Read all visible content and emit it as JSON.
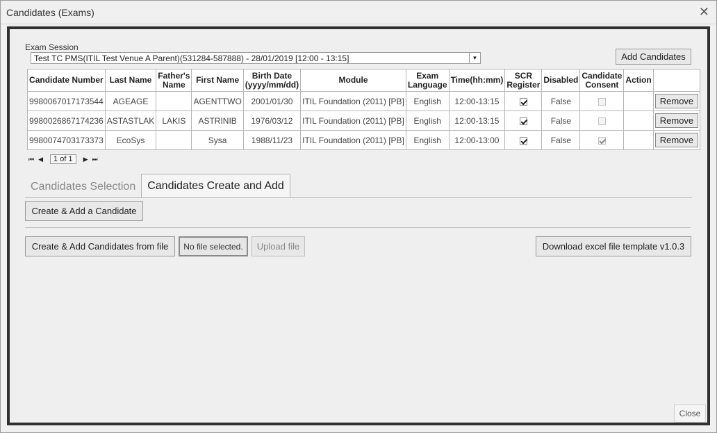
{
  "window": {
    "title": "Candidates (Exams)",
    "close_glyph": "✕"
  },
  "session": {
    "label": "Exam Session",
    "value": "Test TC PMS(ITIL Test Venue A Parent)(531284-587888) - 28/01/2019 [12:00 - 13:15]",
    "dropdown_glyph": "▼"
  },
  "toolbar": {
    "add_candidates": "Add Candidates"
  },
  "table": {
    "headers": {
      "candidate_number": "Candidate Number",
      "last_name": "Last Name",
      "fathers_name_1": "Father's",
      "fathers_name_2": "Name",
      "first_name": "First Name",
      "birth_1": "Birth Date",
      "birth_2": "(yyyy/mm/dd)",
      "module": "Module",
      "exam_lang_1": "Exam",
      "exam_lang_2": "Language",
      "time": "Time(hh:mm)",
      "scr_1": "SCR",
      "scr_2": "Register",
      "disabled": "Disabled",
      "consent_1": "Candidate",
      "consent_2": "Consent",
      "action": "Action"
    },
    "rows": [
      {
        "candidate_number": "9980067017173544",
        "last_name": "AGEAGE",
        "fathers_name": "",
        "first_name": "AGENTTWO",
        "birth_date": "2001/01/30",
        "module": "ITIL Foundation (2011) [PB]",
        "language": "English",
        "time": "12:00-13:15",
        "scr": true,
        "disabled": "False",
        "consent": false,
        "action": "Remove"
      },
      {
        "candidate_number": "9980026867174236",
        "last_name": "ASTASTLAK",
        "fathers_name": "LAKIS",
        "first_name": "ASTRINIB",
        "birth_date": "1976/03/12",
        "module": "ITIL Foundation (2011) [PB]",
        "language": "English",
        "time": "12:00-13:15",
        "scr": true,
        "disabled": "False",
        "consent": false,
        "action": "Remove"
      },
      {
        "candidate_number": "9980074703173373",
        "last_name": "EcoSys",
        "fathers_name": "",
        "first_name": "Sysa",
        "birth_date": "1988/11/23",
        "module": "ITIL Foundation (2011) [PB]",
        "language": "English",
        "time": "12:00-13:00",
        "scr": true,
        "disabled": "False",
        "consent": true,
        "action": "Remove"
      }
    ]
  },
  "pager": {
    "first": "⏮",
    "prev": "◀",
    "page_text": "1 of 1",
    "next": "▶",
    "last": "⏭"
  },
  "tabs": [
    {
      "label": "Candidates Selection",
      "active": false
    },
    {
      "label": "Candidates Create and Add",
      "active": true
    }
  ],
  "actions": {
    "create_one": "Create & Add a Candidate",
    "create_from_file": "Create & Add Candidates from file",
    "file_status": "No file selected.",
    "upload": "Upload file",
    "download_template": "Download excel file template v1.0.3",
    "close": "Close"
  }
}
